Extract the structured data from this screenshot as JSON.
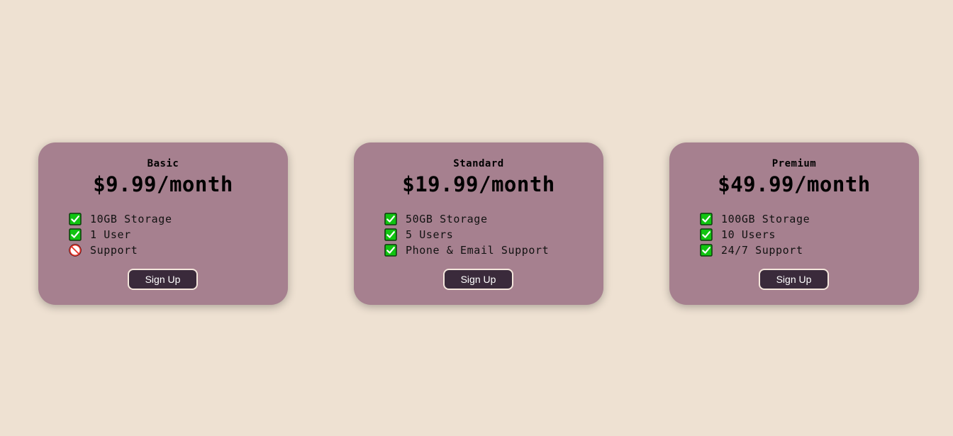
{
  "colors": {
    "page_background": "#EEE1D2",
    "card_background": "#A6808F",
    "button_background": "#3A2A3B",
    "button_border": "#F4E6DC",
    "included_icon": "#11C411",
    "excluded_icon": "#E4342A"
  },
  "plans": [
    {
      "name": "Basic",
      "price": "$9.99/month",
      "features": [
        {
          "text": "10GB Storage",
          "icon": "checkmark-icon",
          "included": true
        },
        {
          "text": "1 User",
          "icon": "checkmark-icon",
          "included": true
        },
        {
          "text": "Support",
          "icon": "prohibited-icon",
          "included": false
        }
      ],
      "button_label": "Sign Up"
    },
    {
      "name": "Standard",
      "price": "$19.99/month",
      "features": [
        {
          "text": "50GB Storage",
          "icon": "checkmark-icon",
          "included": true
        },
        {
          "text": "5 Users",
          "icon": "checkmark-icon",
          "included": true
        },
        {
          "text": "Phone & Email Support",
          "icon": "checkmark-icon",
          "included": true
        }
      ],
      "button_label": "Sign Up"
    },
    {
      "name": "Premium",
      "price": "$49.99/month",
      "features": [
        {
          "text": "100GB Storage",
          "icon": "checkmark-icon",
          "included": true
        },
        {
          "text": "10 Users",
          "icon": "checkmark-icon",
          "included": true
        },
        {
          "text": "24/7 Support",
          "icon": "checkmark-icon",
          "included": true
        }
      ],
      "button_label": "Sign Up"
    }
  ]
}
